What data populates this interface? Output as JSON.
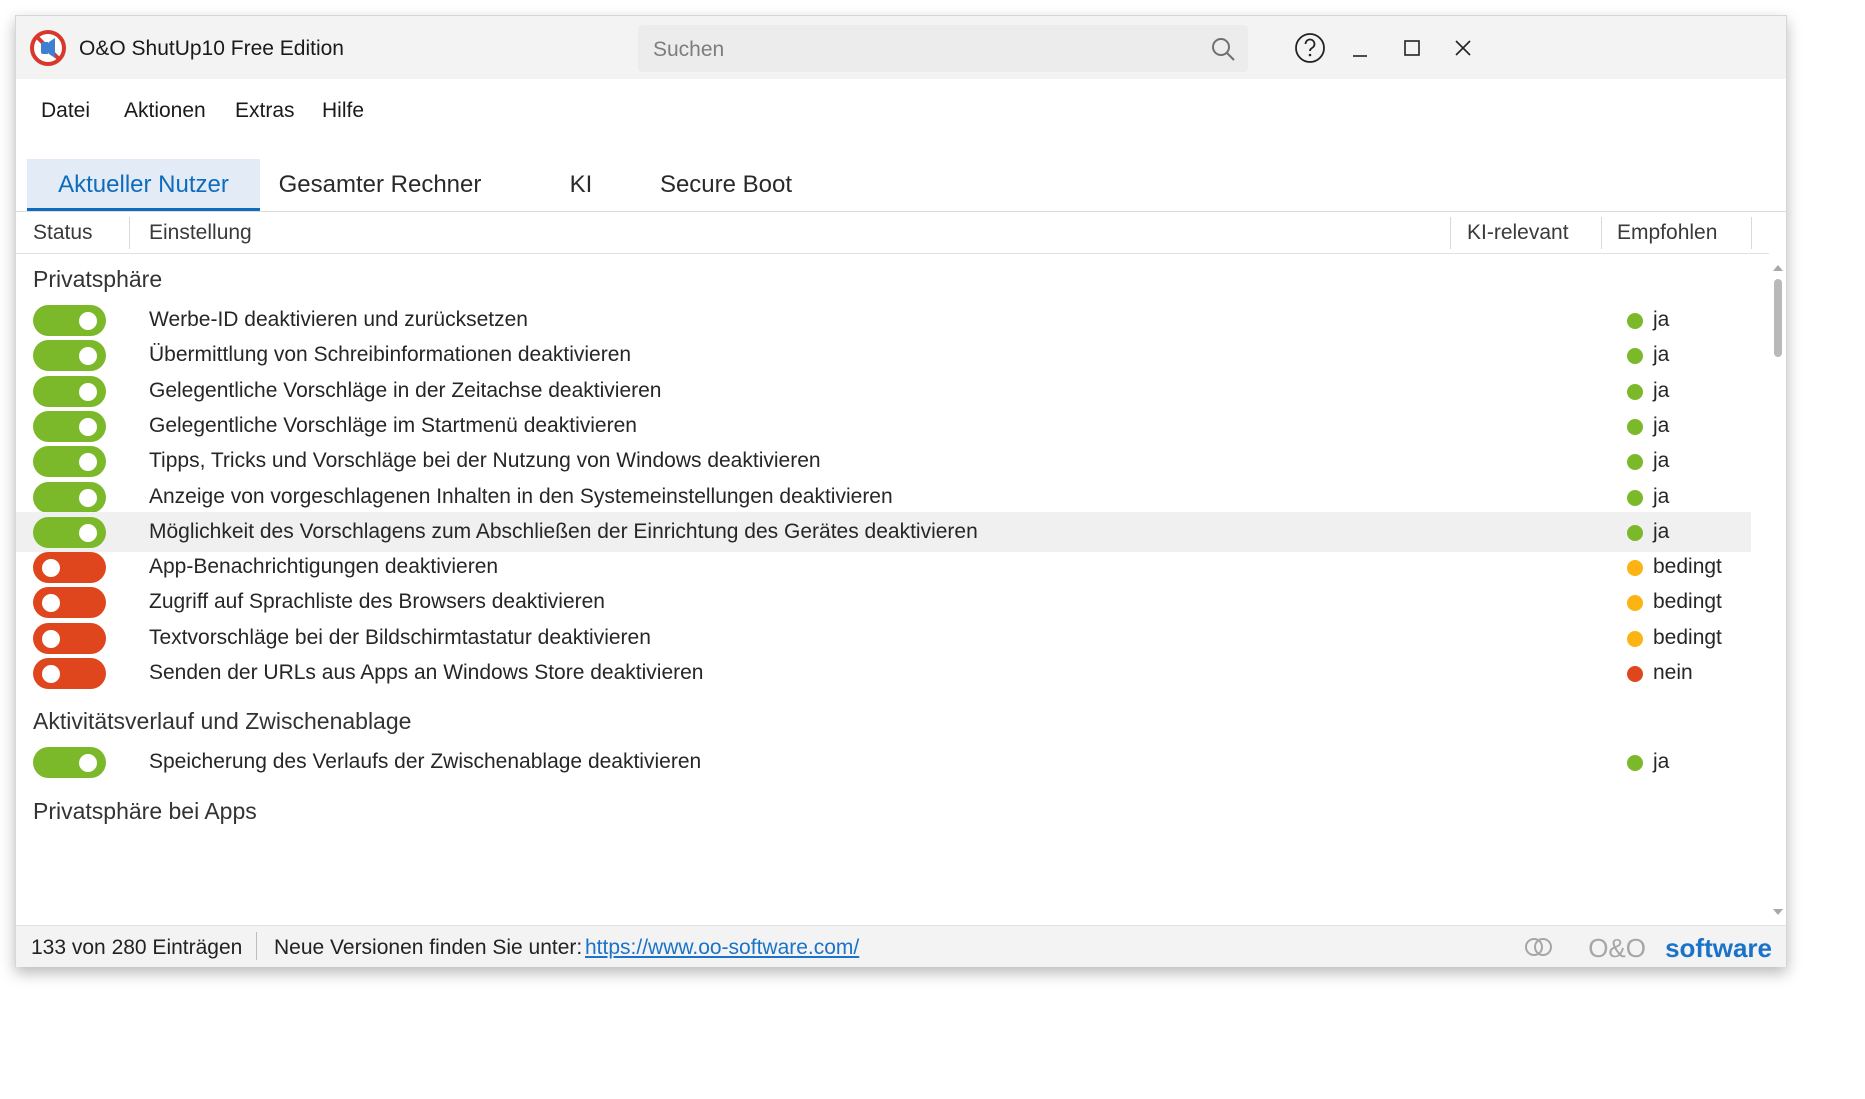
{
  "window": {
    "title": "O&O ShutUp10 Free Edition",
    "search_placeholder": "Suchen"
  },
  "menu": [
    "Datei",
    "Aktionen",
    "Extras",
    "Hilfe"
  ],
  "tabs": [
    "Aktueller Nutzer",
    "Gesamter Rechner",
    "KI",
    "Secure Boot"
  ],
  "active_tab": "Aktueller Nutzer",
  "columns": {
    "status": "Status",
    "setting": "Einstellung",
    "ai": "KI-relevant",
    "recommended": "Empfohlen"
  },
  "groups": [
    {
      "title": "Privatsphäre",
      "rows": [
        {
          "label": "Werbe-ID deaktivieren und zurücksetzen",
          "enabled": true,
          "recommended": "ja"
        },
        {
          "label": "Übermittlung von Schreibinformationen deaktivieren",
          "enabled": true,
          "recommended": "ja"
        },
        {
          "label": "Gelegentliche Vorschläge in der Zeitachse deaktivieren",
          "enabled": true,
          "recommended": "ja"
        },
        {
          "label": "Gelegentliche Vorschläge im Startmenü deaktivieren",
          "enabled": true,
          "recommended": "ja"
        },
        {
          "label": "Tipps, Tricks und Vorschläge bei der Nutzung von Windows deaktivieren",
          "enabled": true,
          "recommended": "ja"
        },
        {
          "label": "Anzeige von vorgeschlagenen Inhalten in den Systemeinstellungen deaktivieren",
          "enabled": true,
          "recommended": "ja"
        },
        {
          "label": "Möglichkeit des Vorschlagens zum Abschließen der Einrichtung des Gerätes deaktivieren",
          "enabled": true,
          "recommended": "ja",
          "highlighted": true
        },
        {
          "label": "App-Benachrichtigungen deaktivieren",
          "enabled": false,
          "recommended": "bedingt"
        },
        {
          "label": "Zugriff auf Sprachliste des Browsers deaktivieren",
          "enabled": false,
          "recommended": "bedingt"
        },
        {
          "label": "Textvorschläge bei der Bildschirmtastatur deaktivieren",
          "enabled": false,
          "recommended": "bedingt"
        },
        {
          "label": "Senden der URLs aus Apps an Windows Store deaktivieren",
          "enabled": false,
          "recommended": "nein"
        }
      ]
    },
    {
      "title": "Aktivitätsverlauf und Zwischenablage",
      "rows": [
        {
          "label": "Speicherung des Verlaufs der Zwischenablage deaktivieren",
          "enabled": true,
          "recommended": "ja"
        }
      ]
    },
    {
      "title": "Privatsphäre bei Apps",
      "rows": []
    }
  ],
  "status_colors": {
    "ja": "#7bb92a",
    "bedingt": "#fbb414",
    "nein": "#e0461d",
    "toggle_on": "#7bb92a",
    "toggle_off": "#e0461d",
    "accent": "#0f6cbd"
  },
  "statusbar": {
    "count": "133 von 280 Einträgen",
    "note": "Neue Versionen finden Sie unter:",
    "link": "https://www.oo-software.com/"
  },
  "brand": {
    "part1": "O&O",
    "part2": "software"
  },
  "icons": {
    "app": "shutup-logo-icon",
    "search": "search-icon",
    "help": "help-icon",
    "minimize": "minimize-icon",
    "maximize": "maximize-icon",
    "close": "close-icon"
  }
}
